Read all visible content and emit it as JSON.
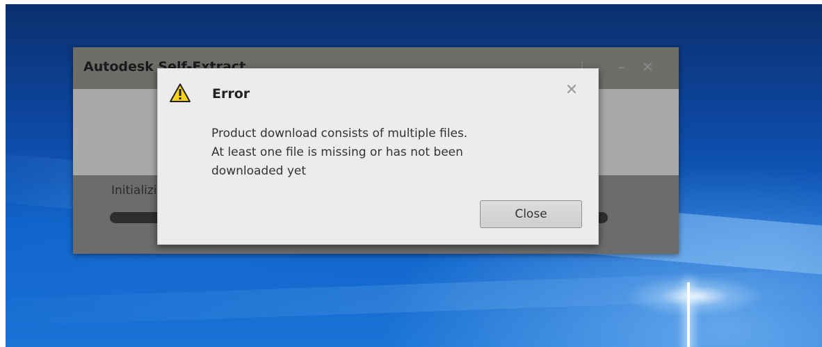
{
  "parent_window": {
    "title": "Autodesk Self-Extract",
    "status_label": "Initializing...",
    "controls": {
      "info_icon": "info-icon",
      "minimize_icon": "minimize-icon",
      "close_icon": "close-icon"
    }
  },
  "dialog": {
    "icon": "warning-icon",
    "title": "Error",
    "message_lines": [
      "Product download consists of multiple files.",
      "At least one file is missing or has not been",
      "downloaded yet"
    ],
    "close_x_icon": "close-icon",
    "close_button_label": "Close"
  },
  "colors": {
    "desktop_blue": "#0f62c9",
    "dialog_bg": "#ececec",
    "warning_yellow": "#f7d21e"
  }
}
